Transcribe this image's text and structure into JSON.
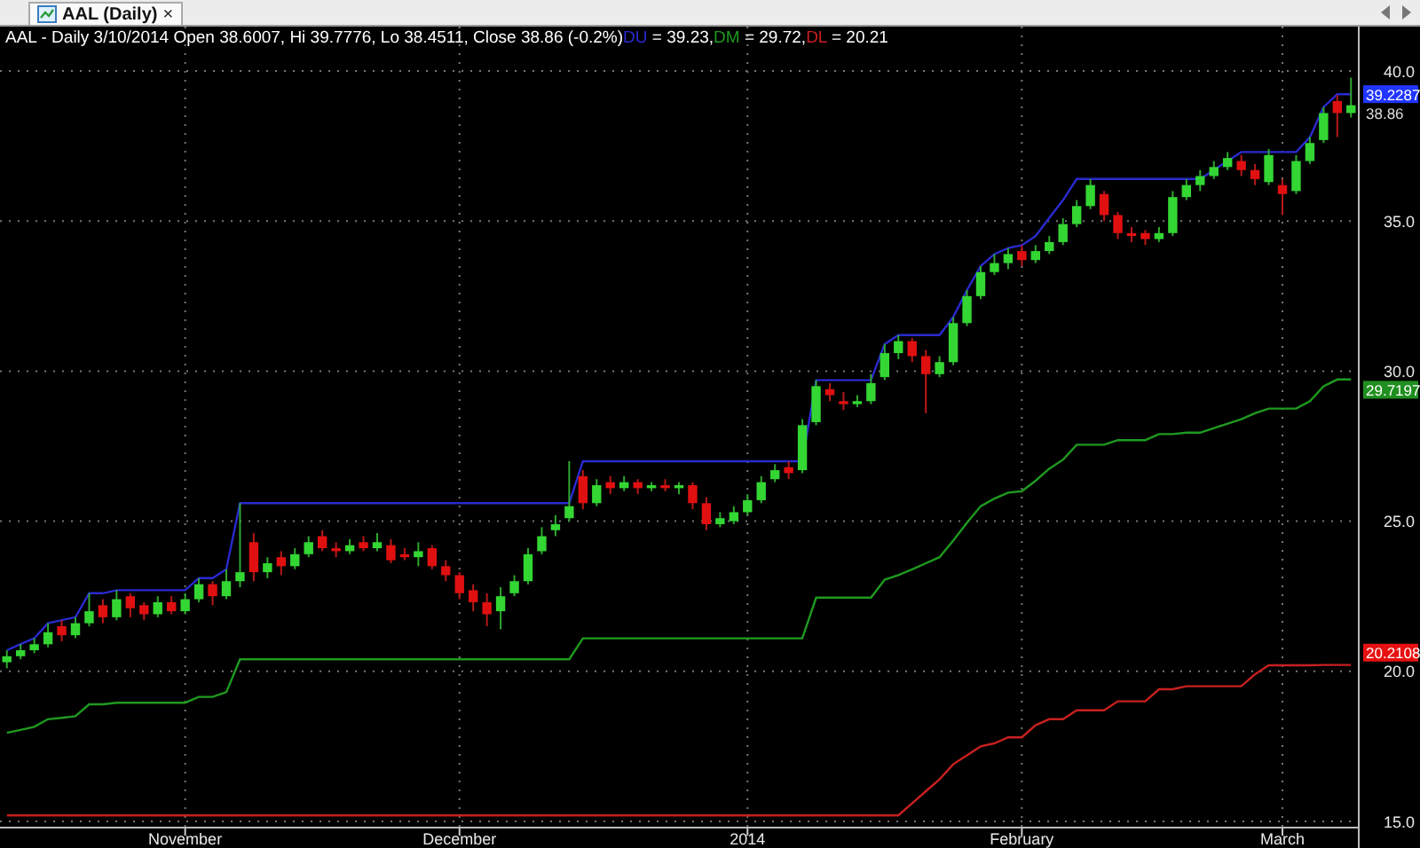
{
  "tab": {
    "label": "AAL (Daily)",
    "close": "×",
    "selected": true
  },
  "chart": {
    "info_line": {
      "text": "AAL - Daily 3/10/2014 Open 38.6007, Hi 39.7776, Lo 38.4511, Close 38.86 (-0.2%)",
      "indicator_values": [
        " = 39.23,",
        " = 29.72,",
        " = 20.21"
      ]
    },
    "chart_data": {
      "type": "candlestick",
      "grid": true,
      "ylim": [
        14.82,
        41.48
      ],
      "categories": [
        null,
        null,
        null,
        null,
        null,
        null,
        null,
        null,
        null,
        null,
        null,
        null,
        null,
        "November",
        null,
        null,
        null,
        null,
        null,
        null,
        null,
        null,
        null,
        null,
        null,
        null,
        null,
        null,
        null,
        null,
        null,
        null,
        null,
        "December",
        null,
        null,
        null,
        null,
        null,
        null,
        null,
        null,
        null,
        null,
        null,
        null,
        null,
        null,
        null,
        null,
        null,
        null,
        null,
        null,
        "2014",
        null,
        null,
        null,
        null,
        null,
        null,
        null,
        null,
        null,
        null,
        null,
        null,
        null,
        null,
        null,
        null,
        null,
        null,
        null,
        "February",
        null,
        null,
        null,
        null,
        null,
        null,
        null,
        null,
        null,
        null,
        null,
        null,
        null,
        null,
        null,
        null,
        null,
        null,
        "March",
        null,
        null,
        null,
        null,
        null
      ],
      "yticks": [
        {
          "value": 15,
          "label": "15.0"
        },
        {
          "value": 20,
          "label": "20.0"
        },
        {
          "value": 25,
          "label": "25.0"
        },
        {
          "value": 30,
          "label": "30.0"
        },
        {
          "value": 35,
          "label": "35.0"
        },
        {
          "value": 40,
          "label": "40.0"
        }
      ],
      "ohlc": [
        [
          20.3,
          20.7,
          20.1,
          20.5
        ],
        [
          20.5,
          20.9,
          20.4,
          20.7
        ],
        [
          20.7,
          21.1,
          20.6,
          20.9
        ],
        [
          20.9,
          21.6,
          20.8,
          21.3
        ],
        [
          21.5,
          21.7,
          21.0,
          21.2
        ],
        [
          21.2,
          21.8,
          21.1,
          21.6
        ],
        [
          21.6,
          22.6,
          21.5,
          22.0
        ],
        [
          22.2,
          22.4,
          21.6,
          21.8
        ],
        [
          21.8,
          22.7,
          21.7,
          22.4
        ],
        [
          22.5,
          22.6,
          21.8,
          22.1
        ],
        [
          22.2,
          22.3,
          21.7,
          21.9
        ],
        [
          21.9,
          22.5,
          21.8,
          22.3
        ],
        [
          22.3,
          22.5,
          21.9,
          22.0
        ],
        [
          22.0,
          22.6,
          21.9,
          22.4
        ],
        [
          22.4,
          23.1,
          22.3,
          22.9
        ],
        [
          22.9,
          23.0,
          22.2,
          22.5
        ],
        [
          22.5,
          23.4,
          22.4,
          23.0
        ],
        [
          23.0,
          25.6,
          22.8,
          23.3
        ],
        [
          24.3,
          24.6,
          23.0,
          23.3
        ],
        [
          23.3,
          23.8,
          23.1,
          23.6
        ],
        [
          23.8,
          24.0,
          23.2,
          23.5
        ],
        [
          23.5,
          24.1,
          23.4,
          23.9
        ],
        [
          23.9,
          24.5,
          23.8,
          24.3
        ],
        [
          24.5,
          24.7,
          24.0,
          24.1
        ],
        [
          24.1,
          24.3,
          23.8,
          24.0
        ],
        [
          24.0,
          24.4,
          23.9,
          24.2
        ],
        [
          24.3,
          24.5,
          24.0,
          24.1
        ],
        [
          24.1,
          24.6,
          24.0,
          24.3
        ],
        [
          24.2,
          24.4,
          23.6,
          23.7
        ],
        [
          23.9,
          24.1,
          23.7,
          23.8
        ],
        [
          23.8,
          24.3,
          23.5,
          24.0
        ],
        [
          24.1,
          24.2,
          23.4,
          23.5
        ],
        [
          23.5,
          23.7,
          23.0,
          23.2
        ],
        [
          23.2,
          23.3,
          22.4,
          22.6
        ],
        [
          22.7,
          22.9,
          22.0,
          22.3
        ],
        [
          22.3,
          22.6,
          21.5,
          21.9
        ],
        [
          22.0,
          22.8,
          21.4,
          22.5
        ],
        [
          22.6,
          23.2,
          22.5,
          23.0
        ],
        [
          23.0,
          24.1,
          22.9,
          23.9
        ],
        [
          24.0,
          24.8,
          23.9,
          24.5
        ],
        [
          24.7,
          25.2,
          24.5,
          24.9
        ],
        [
          25.1,
          27.0,
          25.0,
          25.5
        ],
        [
          26.5,
          26.7,
          25.4,
          25.6
        ],
        [
          25.6,
          26.4,
          25.5,
          26.2
        ],
        [
          26.3,
          26.5,
          25.9,
          26.1
        ],
        [
          26.1,
          26.5,
          26.0,
          26.3
        ],
        [
          26.3,
          26.4,
          25.9,
          26.1
        ],
        [
          26.1,
          26.3,
          26.0,
          26.2
        ],
        [
          26.2,
          26.4,
          26.0,
          26.1
        ],
        [
          26.1,
          26.3,
          25.9,
          26.2
        ],
        [
          26.2,
          26.3,
          25.4,
          25.6
        ],
        [
          25.6,
          25.8,
          24.7,
          24.9
        ],
        [
          24.9,
          25.3,
          24.8,
          25.1
        ],
        [
          25.0,
          25.5,
          24.9,
          25.3
        ],
        [
          25.3,
          25.9,
          25.2,
          25.7
        ],
        [
          25.7,
          26.5,
          25.6,
          26.3
        ],
        [
          26.4,
          26.9,
          26.3,
          26.7
        ],
        [
          26.8,
          27.0,
          26.4,
          26.6
        ],
        [
          26.7,
          28.4,
          26.6,
          28.2
        ],
        [
          28.3,
          29.7,
          28.2,
          29.5
        ],
        [
          29.4,
          29.6,
          29.0,
          29.2
        ],
        [
          29.0,
          29.3,
          28.7,
          28.9
        ],
        [
          28.9,
          29.2,
          28.8,
          29.0
        ],
        [
          29.0,
          29.9,
          28.9,
          29.6
        ],
        [
          29.8,
          30.9,
          29.7,
          30.6
        ],
        [
          30.6,
          31.2,
          30.4,
          31.0
        ],
        [
          31.0,
          31.1,
          30.3,
          30.5
        ],
        [
          30.5,
          30.7,
          28.6,
          29.9
        ],
        [
          29.9,
          30.5,
          29.8,
          30.3
        ],
        [
          30.3,
          31.8,
          30.2,
          31.6
        ],
        [
          31.6,
          32.7,
          31.5,
          32.5
        ],
        [
          32.5,
          33.5,
          32.4,
          33.3
        ],
        [
          33.3,
          33.9,
          33.2,
          33.6
        ],
        [
          33.6,
          34.1,
          33.4,
          33.9
        ],
        [
          34.0,
          34.2,
          33.5,
          33.7
        ],
        [
          33.7,
          34.2,
          33.6,
          34.0
        ],
        [
          34.0,
          34.5,
          33.9,
          34.3
        ],
        [
          34.3,
          35.1,
          34.2,
          34.9
        ],
        [
          34.9,
          35.7,
          34.8,
          35.5
        ],
        [
          35.5,
          36.4,
          35.4,
          36.2
        ],
        [
          35.9,
          36.0,
          35.0,
          35.2
        ],
        [
          35.2,
          35.3,
          34.4,
          34.6
        ],
        [
          34.6,
          34.8,
          34.3,
          34.5
        ],
        [
          34.6,
          34.7,
          34.2,
          34.4
        ],
        [
          34.4,
          34.8,
          34.3,
          34.6
        ],
        [
          34.6,
          36.0,
          34.5,
          35.8
        ],
        [
          35.8,
          36.4,
          35.7,
          36.2
        ],
        [
          36.2,
          36.7,
          36.0,
          36.5
        ],
        [
          36.5,
          37.0,
          36.4,
          36.8
        ],
        [
          36.8,
          37.3,
          36.7,
          37.1
        ],
        [
          37.0,
          37.2,
          36.5,
          36.7
        ],
        [
          36.7,
          36.9,
          36.2,
          36.4
        ],
        [
          36.3,
          37.4,
          36.2,
          37.2
        ],
        [
          36.2,
          36.4,
          35.2,
          35.9
        ],
        [
          36.0,
          37.2,
          35.9,
          37.0
        ],
        [
          37.0,
          37.8,
          36.9,
          37.6
        ],
        [
          37.7,
          38.8,
          37.6,
          38.6
        ],
        [
          39.0,
          39.2,
          37.8,
          38.6
        ],
        [
          38.6,
          39.78,
          38.45,
          38.86
        ]
      ],
      "series": [
        {
          "name": "DU",
          "type": "line",
          "color": "#2a2ad0",
          "values": [
            20.7,
            20.9,
            21.1,
            21.6,
            21.7,
            21.8,
            22.6,
            22.6,
            22.7,
            22.7,
            22.7,
            22.7,
            22.7,
            22.7,
            23.1,
            23.1,
            23.4,
            25.6,
            25.6,
            25.6,
            25.6,
            25.6,
            25.6,
            25.6,
            25.6,
            25.6,
            25.6,
            25.6,
            25.6,
            25.6,
            25.6,
            25.6,
            25.6,
            25.6,
            25.6,
            25.6,
            25.6,
            25.6,
            25.6,
            25.6,
            25.6,
            25.6,
            27.0,
            27.0,
            27.0,
            27.0,
            27.0,
            27.0,
            27.0,
            27.0,
            27.0,
            27.0,
            27.0,
            27.0,
            27.0,
            27.0,
            27.0,
            27.0,
            27.0,
            29.7,
            29.7,
            29.7,
            29.7,
            29.7,
            30.9,
            31.2,
            31.2,
            31.2,
            31.2,
            31.8,
            32.7,
            33.5,
            33.9,
            34.1,
            34.2,
            34.5,
            35.1,
            35.7,
            36.4,
            36.4,
            36.4,
            36.4,
            36.4,
            36.4,
            36.4,
            36.4,
            36.4,
            36.4,
            36.7,
            37.0,
            37.3,
            37.3,
            37.3,
            37.3,
            37.3,
            37.8,
            38.8,
            39.23,
            39.23
          ]
        },
        {
          "name": "DM",
          "type": "line",
          "color": "#1f9a1f",
          "values": [
            17.95,
            18.05,
            18.15,
            18.4,
            18.45,
            18.5,
            18.9,
            18.9,
            18.95,
            18.95,
            18.95,
            18.95,
            18.95,
            18.95,
            19.15,
            19.15,
            19.3,
            20.4,
            20.4,
            20.4,
            20.4,
            20.4,
            20.4,
            20.4,
            20.4,
            20.4,
            20.4,
            20.4,
            20.4,
            20.4,
            20.4,
            20.4,
            20.4,
            20.4,
            20.4,
            20.4,
            20.4,
            20.4,
            20.4,
            20.4,
            20.4,
            20.4,
            21.1,
            21.1,
            21.1,
            21.1,
            21.1,
            21.1,
            21.1,
            21.1,
            21.1,
            21.1,
            21.1,
            21.1,
            21.1,
            21.1,
            21.1,
            21.1,
            21.1,
            22.45,
            22.45,
            22.45,
            22.45,
            22.45,
            23.05,
            23.2,
            23.4,
            23.6,
            23.8,
            24.35,
            24.95,
            25.5,
            25.75,
            25.95,
            26.0,
            26.35,
            26.75,
            27.05,
            27.55,
            27.55,
            27.55,
            27.7,
            27.7,
            27.7,
            27.9,
            27.9,
            27.95,
            27.95,
            28.1,
            28.25,
            28.4,
            28.6,
            28.75,
            28.75,
            28.75,
            29.0,
            29.5,
            29.72,
            29.72
          ]
        },
        {
          "name": "DL",
          "type": "line",
          "color": "#c82020",
          "values": [
            15.2,
            15.2,
            15.2,
            15.2,
            15.2,
            15.2,
            15.2,
            15.2,
            15.2,
            15.2,
            15.2,
            15.2,
            15.2,
            15.2,
            15.2,
            15.2,
            15.2,
            15.2,
            15.2,
            15.2,
            15.2,
            15.2,
            15.2,
            15.2,
            15.2,
            15.2,
            15.2,
            15.2,
            15.2,
            15.2,
            15.2,
            15.2,
            15.2,
            15.2,
            15.2,
            15.2,
            15.2,
            15.2,
            15.2,
            15.2,
            15.2,
            15.2,
            15.2,
            15.2,
            15.2,
            15.2,
            15.2,
            15.2,
            15.2,
            15.2,
            15.2,
            15.2,
            15.2,
            15.2,
            15.2,
            15.2,
            15.2,
            15.2,
            15.2,
            15.2,
            15.2,
            15.2,
            15.2,
            15.2,
            15.2,
            15.2,
            15.6,
            16.0,
            16.4,
            16.9,
            17.2,
            17.5,
            17.6,
            17.8,
            17.8,
            18.2,
            18.4,
            18.4,
            18.7,
            18.7,
            18.7,
            19.0,
            19.0,
            19.0,
            19.4,
            19.4,
            19.5,
            19.5,
            19.5,
            19.5,
            19.5,
            19.9,
            20.2,
            20.2,
            20.2,
            20.2,
            20.21,
            20.21,
            20.21
          ]
        }
      ]
    },
    "price_tags": [
      {
        "kind": "series_value",
        "text": "39.2287",
        "color": "#2035ff"
      },
      {
        "kind": "last_close",
        "text": "38.86"
      },
      {
        "kind": "series_value",
        "text": "29.7197",
        "color": "#1f8f1f"
      },
      {
        "kind": "series_value",
        "text": "20.2108",
        "color": "#e81010"
      }
    ]
  }
}
